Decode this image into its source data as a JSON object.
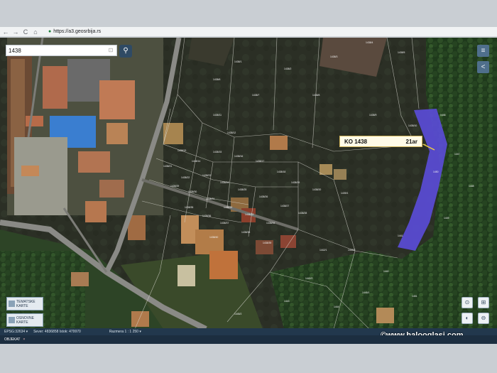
{
  "browser": {
    "back": "←",
    "forward": "→",
    "reload": "C",
    "home": "⌂",
    "url": "https://a3.geosrbija.rs"
  },
  "search": {
    "value": "1438",
    "clear": "⊡",
    "button": "⚲"
  },
  "side_buttons": [
    {
      "name": "menu-icon",
      "glyph": "≡"
    },
    {
      "name": "collapse-icon",
      "glyph": "<"
    }
  ],
  "parcel_label": {
    "ko": "KO 1438",
    "area": "21ar"
  },
  "layers": {
    "thematic": "TEMATSKE\nKARTE",
    "base": "OSNOVNE\nKARTE"
  },
  "tools": [
    {
      "name": "measure-icon",
      "glyph": "⊙"
    },
    {
      "name": "print-icon",
      "glyph": "⊞"
    },
    {
      "name": "info-icon",
      "glyph": "◐"
    },
    {
      "name": "zoom-out-icon",
      "glyph": "⊖"
    }
  ],
  "status": {
    "epsg": "EPSG:32634 ▾",
    "coords": "Sever: 4836858 Istok: 479970",
    "scale": "Razmera 1 : 1 250 ▾"
  },
  "watermark": "©www.halooglasi.com",
  "bottom_tab": {
    "label": "OBJEKAT",
    "close": "×"
  },
  "parcels": [
    "1438/1",
    "1438/2",
    "1438/3",
    "1438/4",
    "1438/5",
    "1438/6",
    "1438/7",
    "1438/8",
    "1438/9",
    "1438/10",
    "1438/11",
    "1438/12",
    "1438/13",
    "1438/14",
    "1438/15",
    "1438/16",
    "1438/17",
    "1438/18",
    "1438/19",
    "1438/20",
    "1438/21",
    "1438/22",
    "1438/23",
    "1438/24",
    "1438/25",
    "1438/26",
    "1438/27",
    "1438/28",
    "1438/29",
    "1438/30",
    "1438/31",
    "1438/32",
    "1438/33",
    "1438/34",
    "1438/35",
    "1438/36",
    "1438/37",
    "1438/38",
    "1438/39",
    "1438/40",
    "1439/1",
    "1439/2",
    "1440",
    "1441",
    "1442/1",
    "1442/2",
    "1443",
    "1444",
    "1445/1",
    "1445/2",
    "1446",
    "1447",
    "1448",
    "1449",
    "1450",
    "1451"
  ]
}
